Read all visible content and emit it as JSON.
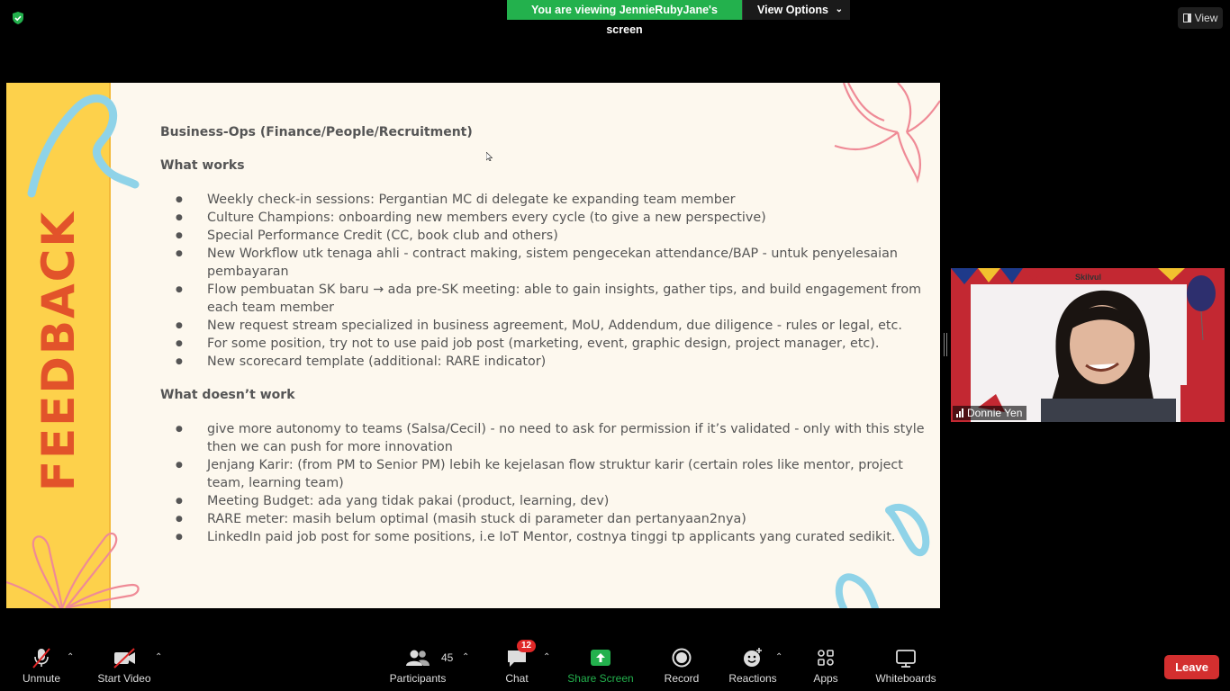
{
  "top": {
    "viewing_label": "You are viewing JennieRubyJane's screen",
    "view_options_label": "View Options",
    "view_label": "View"
  },
  "slide": {
    "side_title": "FEEDBACK",
    "heading": "Business-Ops (Finance/People/Recruitment)",
    "works_title": "What works",
    "works": [
      "Weekly check-in sessions: Pergantian MC di delegate ke expanding team member",
      "Culture Champions: onboarding new members every cycle (to give a new perspective)",
      "Special Performance Credit (CC, book club and others)",
      "New Workflow utk tenaga ahli - contract making, sistem pengecekan attendance/BAP - untuk penyelesaian pembayaran",
      "Flow pembuatan SK baru → ada pre-SK meeting: able to gain insights, gather tips, and build engagement from each team member",
      "New request stream specialized in business agreement, MoU, Addendum, due diligence - rules or legal, etc.",
      "For some position, try not to use paid job post (marketing, event, graphic design, project manager, etc).",
      "New scorecard template (additional: RARE indicator)"
    ],
    "doesnt_title": "What doesn’t work",
    "doesnt": [
      "give more autonomy to teams (Salsa/Cecil) - no need to ask for permission if it’s validated - only with this style then we can push for more innovation",
      "Jenjang Karir: (from PM to Senior PM) lebih ke kejelasan flow struktur karir (certain roles like mentor, project team, learning team)",
      "Meeting Budget: ada yang tidak pakai (product, learning, dev)",
      "RARE meter: masih belum optimal (masih stuck di parameter dan pertanyaan2nya)",
      "LinkedIn paid job post for some positions, i.e IoT Mentor, costnya tinggi tp applicants yang curated sedikit."
    ]
  },
  "participant_video": {
    "name": "Donnie Yen",
    "banner_text": "Skilvul"
  },
  "toolbar": {
    "unmute_label": "Unmute",
    "start_video_label": "Start Video",
    "participants_label": "Participants",
    "participants_count": "45",
    "chat_label": "Chat",
    "chat_badge": "12",
    "share_screen_label": "Share Screen",
    "record_label": "Record",
    "reactions_label": "Reactions",
    "apps_label": "Apps",
    "whiteboards_label": "Whiteboards",
    "leave_label": "Leave"
  },
  "colors": {
    "accent_green": "#23b14d",
    "leave_red": "#d32f2f",
    "slide_yellow": "#fdd14b",
    "feedback_orange": "#e2532a"
  }
}
